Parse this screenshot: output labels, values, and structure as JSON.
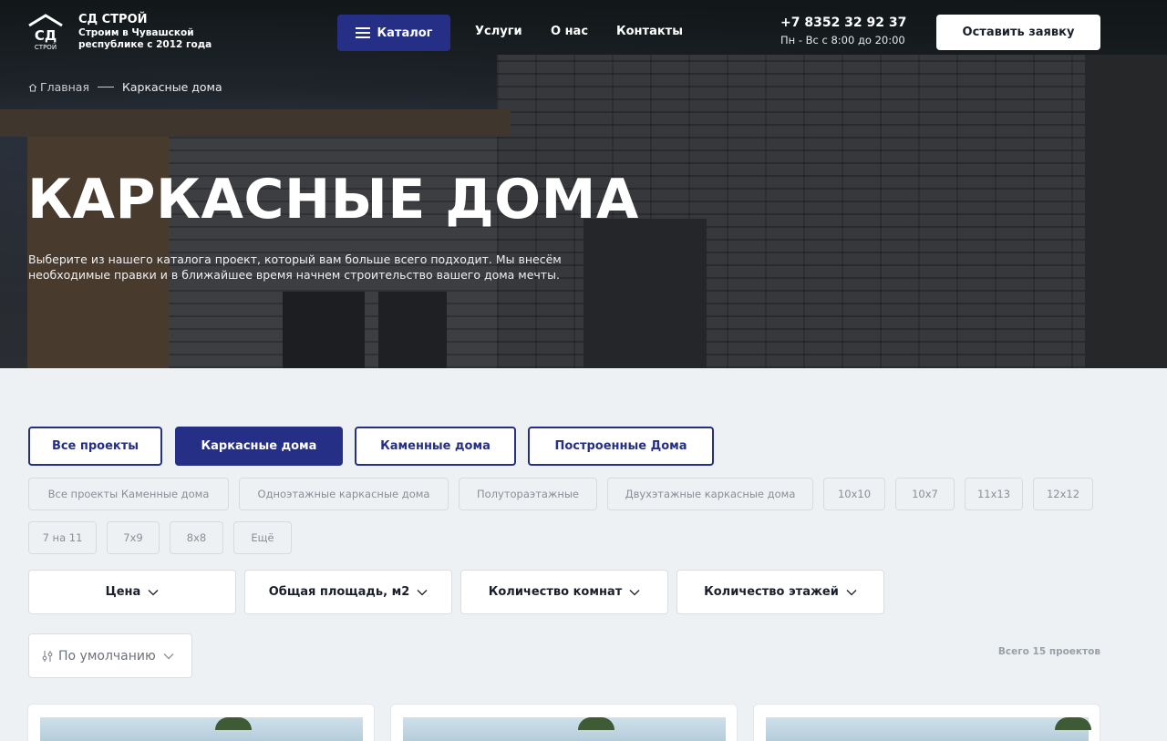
{
  "header": {
    "logo_mark": "СД",
    "logo_mark_sub": "СТРОЙ",
    "company_name": "СД СТРОЙ",
    "tagline": "Строим в Чувашской республике с 2012 года",
    "catalog_label": "Каталог",
    "nav": [
      "Услуги",
      "О нас",
      "Контакты"
    ],
    "phone": "+7 8352 32 92 37",
    "hours": "Пн - Вс с 8:00 до 20:00",
    "request_label": "Оставить заявку"
  },
  "breadcrumb": {
    "home": "Главная",
    "current": "Каркасные дома"
  },
  "hero": {
    "title": "КАРКАСНЫЕ ДОМА",
    "description": "Выберите из нашего каталога проект, который вам больше всего подходит. Мы внесём необходимые правки и в ближайшее время начнем строительство вашего дома мечты."
  },
  "tabs": [
    {
      "label": "Все проекты",
      "active": false
    },
    {
      "label": "Каркасные дома",
      "active": true
    },
    {
      "label": "Каменные дома",
      "active": false
    },
    {
      "label": "Построенные Дома",
      "active": false
    }
  ],
  "chips": [
    "Все проекты Каменные дома",
    "Одноэтажные каркасные дома",
    "Полутораэтажные",
    "Двухэтажные каркасные дома",
    "10x10",
    "10x7",
    "11x13",
    "12x12",
    "7 на 11",
    "7x9",
    "8x8",
    "Ещё"
  ],
  "filters": [
    "Цена",
    "Общая площадь, м2",
    "Количество комнат",
    "Количество этажей"
  ],
  "sort": {
    "label": "По умолчанию"
  },
  "results_count": "Всего 15 проектов",
  "colors": {
    "accent": "#252f86",
    "background": "#eef1f3"
  },
  "icons": {
    "logo": "house-logo-icon",
    "catalog": "menu-icon",
    "home": "home-icon",
    "chevron": "chevron-down-icon",
    "sort": "sliders-icon"
  }
}
